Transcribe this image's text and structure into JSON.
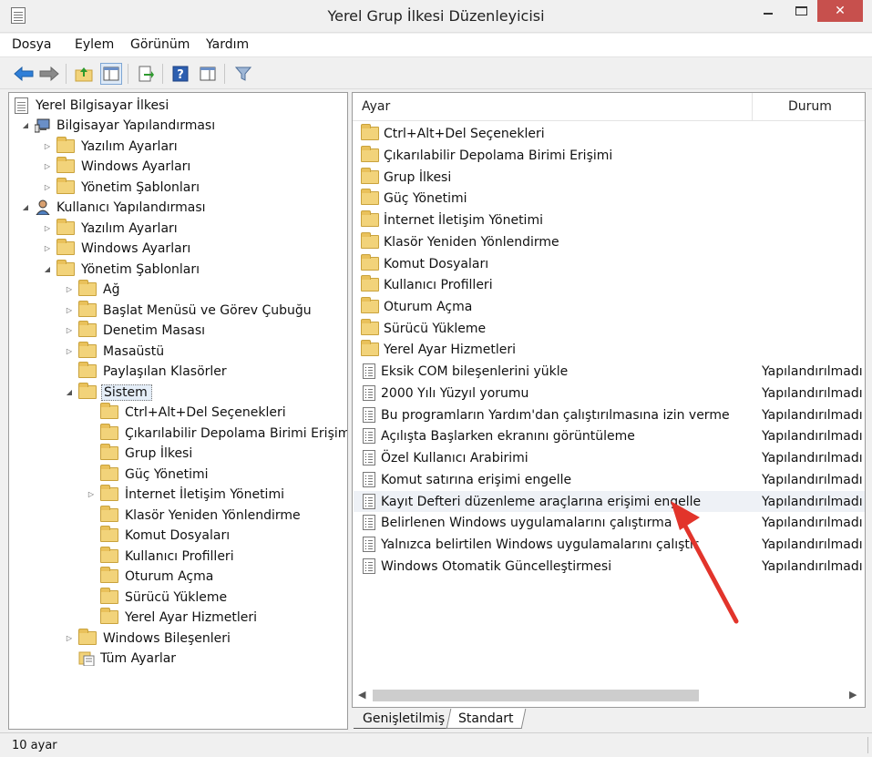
{
  "window": {
    "title": "Yerel Grup İlkesi Düzenleyicisi",
    "close_glyph": "✕"
  },
  "menu": {
    "items": [
      "Dosya",
      "Eylem",
      "Görünüm",
      "Yardım"
    ]
  },
  "tree": {
    "root": "Yerel Bilgisayar İlkesi",
    "computer_config": "Bilgisayar Yapılandırması",
    "computer_children": [
      "Yazılım Ayarları",
      "Windows Ayarları",
      "Yönetim Şablonları"
    ],
    "user_config": "Kullanıcı Yapılandırması",
    "user_children": [
      "Yazılım Ayarları",
      "Windows Ayarları",
      "Yönetim Şablonları"
    ],
    "admin_templates_children": [
      "Ağ",
      "Başlat Menüsü ve Görev Çubuğu",
      "Denetim Masası",
      "Masaüstü",
      "Paylaşılan Klasörler",
      "Sistem"
    ],
    "system_children": [
      "Ctrl+Alt+Del Seçenekleri",
      "Çıkarılabilir Depolama Birimi Erişimi",
      "Grup İlkesi",
      "Güç Yönetimi",
      "İnternet İletişim Yönetimi",
      "Klasör Yeniden Yönlendirme",
      "Komut Dosyaları",
      "Kullanıcı Profilleri",
      "Oturum Açma",
      "Sürücü Yükleme",
      "Yerel Ayar Hizmetleri"
    ],
    "after_system": [
      "Windows Bileşenleri",
      "Tüm Ayarlar"
    ]
  },
  "list": {
    "col_setting": "Ayar",
    "col_state": "Durum",
    "folders": [
      "Ctrl+Alt+Del Seçenekleri",
      "Çıkarılabilir Depolama Birimi Erişimi",
      "Grup İlkesi",
      "Güç Yönetimi",
      "İnternet İletişim Yönetimi",
      "Klasör Yeniden Yönlendirme",
      "Komut Dosyaları",
      "Kullanıcı Profilleri",
      "Oturum Açma",
      "Sürücü Yükleme",
      "Yerel Ayar Hizmetleri"
    ],
    "settings": [
      {
        "name": "Eksik COM bileşenlerini yükle",
        "state": "Yapılandırılmadı"
      },
      {
        "name": "2000 Yılı Yüzyıl yorumu",
        "state": "Yapılandırılmadı"
      },
      {
        "name": "Bu programların Yardım'dan çalıştırılmasına izin verme",
        "state": "Yapılandırılmadı"
      },
      {
        "name": "Açılışta Başlarken ekranını görüntüleme",
        "state": "Yapılandırılmadı"
      },
      {
        "name": "Özel Kullanıcı Arabirimi",
        "state": "Yapılandırılmadı"
      },
      {
        "name": "Komut satırına erişimi engelle",
        "state": "Yapılandırılmadı"
      },
      {
        "name": "Kayıt Defteri düzenleme araçlarına erişimi engelle",
        "state": "Yapılandırılmadı"
      },
      {
        "name": "Belirlenen Windows uygulamalarını çalıştırma",
        "state": "Yapılandırılmadı"
      },
      {
        "name": "Yalnızca belirtilen Windows uygulamalarını çalıştır",
        "state": "Yapılandırılmadı"
      },
      {
        "name": "Windows Otomatik Güncelleştirmesi",
        "state": "Yapılandırılmadı"
      }
    ]
  },
  "tabs": {
    "extended": "Genişletilmiş",
    "standard": "Standart"
  },
  "status": {
    "text": "10 ayar"
  },
  "colors": {
    "annotation_arrow": "#e2342b",
    "folder": "#f2d37a",
    "close_button": "#c7504d"
  }
}
